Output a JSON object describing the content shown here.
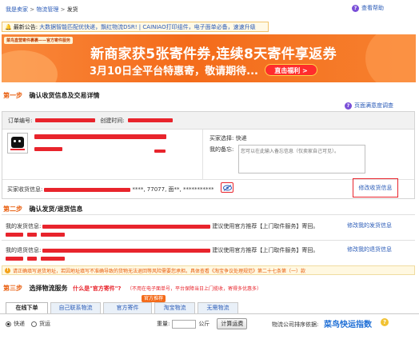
{
  "breadcrumb": {
    "seller": "我是卖家",
    "logistics": "物流管理",
    "current": "发货",
    "sep": ">"
  },
  "help": {
    "label": "查看帮助"
  },
  "notice": {
    "prefix": "最新公告:",
    "text": "大数据智能匹配优快递，飘红物流DSR! | CAINIAO打印组件，电子面单必备，速速升级"
  },
  "banner": {
    "tag": "菜鸟直营寄件裹裹——官方寄件服务",
    "headline": "新商家获5张寄件券,连续8天寄件享返券",
    "subline": "3月10日全平台特惠寄，敬请期待...",
    "cta": "直击福利 >"
  },
  "step1": {
    "step": "第一步",
    "title": "确认收货信息及交易详情",
    "survey_link": "页面满意度调查",
    "order_no_label": "订单编号:",
    "created_label": "创建时间:",
    "buyer_choice_label": "买家选择:",
    "buyer_choice_value": "快递",
    "memo_label": "我的备忘:",
    "memo_placeholder": "您可以在此输入备忘信息（仅卖家自己可见）。",
    "buyer_addr_label": "买家收货信息:",
    "buyer_addr_tail": "****, 77077, 面**, ***********",
    "edit_recv_link": "修改收货信息"
  },
  "step2": {
    "step": "第二步",
    "title": "确认发货/退货信息",
    "ship_label": "我的发货信息:",
    "ship_suffix": "建议使用官方推荐【上门取件服务】寄回。",
    "edit_ship_link": "修改我的发货信息",
    "return_label": "我的退货信息:",
    "return_suffix": "建议使用官方推荐【上门取件服务】寄回。",
    "edit_return_link": "修改我的退货信息",
    "warning": "请正确填写退货地址，若因地址填写不准确导致的货物无法退回等风险需要您承担。具体查看《淘宝争议处理规范》第二十七条第（一）款"
  },
  "step3": {
    "step": "第三步",
    "title": "选择物流服务",
    "official_q": "什么是\"官方寄件\"?",
    "official_note": "（不用在电子面单号，平台保障当日上门揽收，寄得多优惠多）",
    "recommend_badge": "官方推荐",
    "tabs": [
      {
        "label": "在线下单",
        "active": true
      },
      {
        "label": "自己联系物流",
        "active": false
      },
      {
        "label": "官方寄件",
        "active": false
      },
      {
        "label": "淘宝物流",
        "active": false
      },
      {
        "label": "无需物流",
        "active": false
      }
    ],
    "radio_express": "快递",
    "radio_freight": "货运",
    "weight_label": "重量:",
    "weight_unit": "公斤",
    "calc_button": "计算运费",
    "sort_label": "物流公司排序依据:",
    "cainiao_index": "菜鸟快运指数",
    "info_mark": "?"
  },
  "colors": {
    "link": "#2a5bb7",
    "step_orange": "#e85b0a",
    "mask_red": "#e8242c",
    "banner_orange": "#f46b1a"
  }
}
